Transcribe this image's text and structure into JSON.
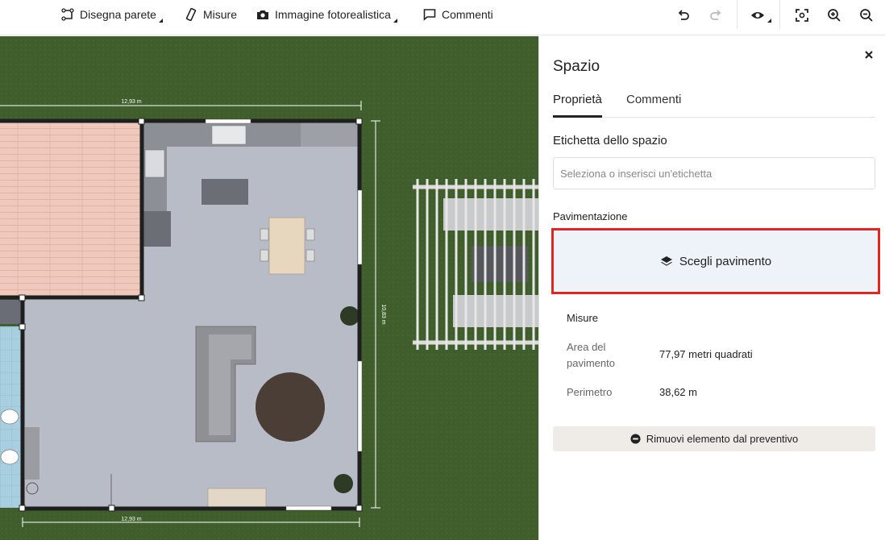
{
  "toolbar": {
    "draw_wall": "Disegna parete",
    "measures": "Misure",
    "photo_image": "Immagine fotorealistica",
    "comments": "Commenti",
    "icons": [
      "undo-icon",
      "redo-icon",
      "eye-icon",
      "fit-view-icon",
      "zoom-in-icon",
      "zoom-out-icon"
    ]
  },
  "plan": {
    "dim_top": "12,93 m",
    "dim_bottom": "12,93 m",
    "dim_right": "10,83 m"
  },
  "panel": {
    "title": "Spazio",
    "tabs": [
      {
        "label": "Proprietà",
        "active": true
      },
      {
        "label": "Commenti",
        "active": false
      }
    ],
    "space_label_heading": "Etichetta dello spazio",
    "space_label_placeholder": "Seleziona o inserisci un'etichetta",
    "flooring_heading": "Pavimentazione",
    "choose_floor_button": "Scegli pavimento",
    "measures": {
      "title": "Misure",
      "floor_area_label": "Area del pavimento",
      "floor_area_value": "77,97 metri quadrati",
      "perimeter_label": "Perimetro",
      "perimeter_value": "38,62 m"
    },
    "remove_button": "Rimuovi elemento dal preventivo"
  },
  "colors": {
    "grass": "#3f5e2c",
    "highlight": "#e52421",
    "floor_button_bg": "#eef3fa",
    "remove_button_bg": "#efece8"
  }
}
